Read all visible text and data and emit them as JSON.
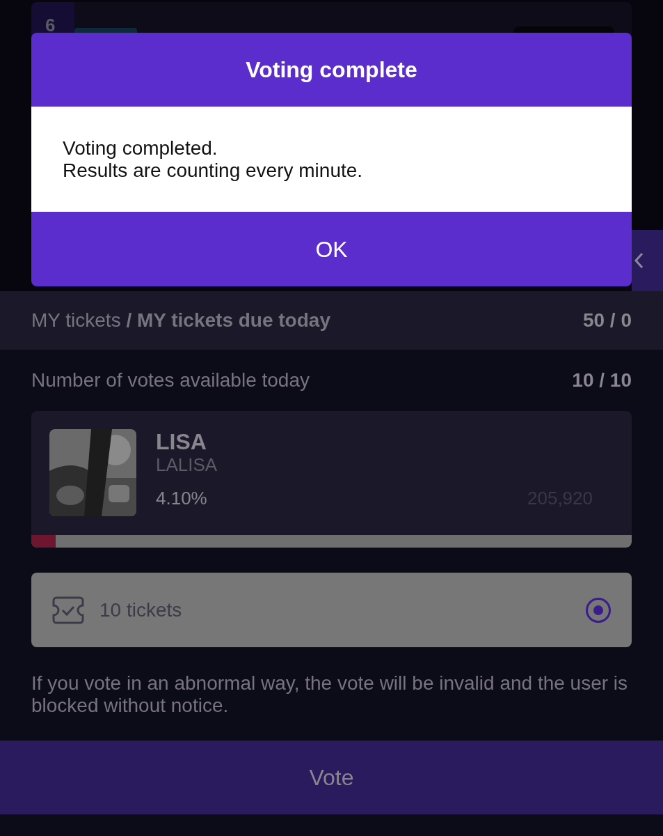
{
  "background_card": {
    "rank": "6"
  },
  "dialog": {
    "title": "Voting complete",
    "message_lines": [
      "Voting completed.",
      "Results are counting every minute."
    ],
    "ok_button": "OK"
  },
  "tickets_summary": {
    "label": "MY tickets **/ MY tickets due today**",
    "value": "50 / 0"
  },
  "votes_available": {
    "label": "Number of votes available today",
    "value": "10 / 10"
  },
  "candidate": {
    "kind": "picture",
    "name": "LISA",
    "subtitle": "LALISA",
    "percent": "4.10%",
    "votes": "205,920",
    "level": 0.041
  },
  "ticket_option": {
    "label": "10 tickets",
    "selected": true
  },
  "notice": "If you vote in an abnormal way, the vote will be invalid and the user is blocked without notice.",
  "vote_button": "Vote"
}
